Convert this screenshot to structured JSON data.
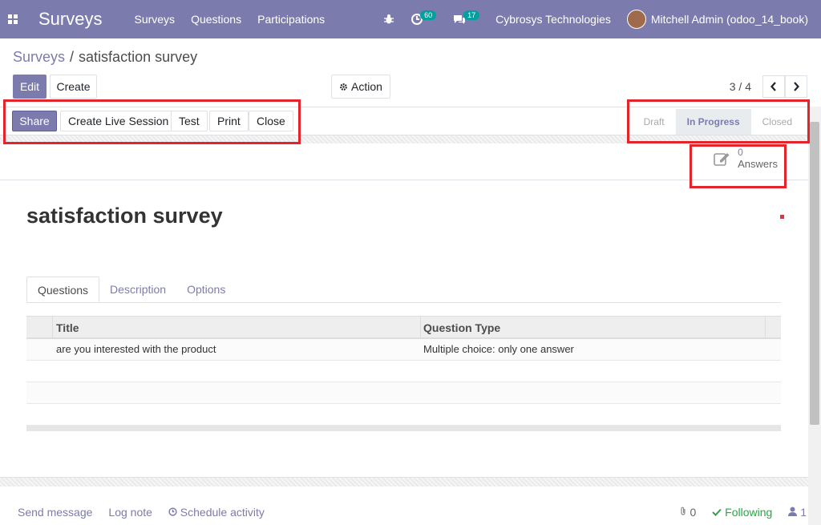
{
  "navbar": {
    "brand": "Surveys",
    "menu": [
      "Surveys",
      "Questions",
      "Participations"
    ],
    "activity_count": "60",
    "message_count": "17",
    "company": "Cybrosys Technologies",
    "user": "Mitchell Admin (odoo_14_book)"
  },
  "breadcrumb": {
    "parent": "Surveys",
    "separator": "/",
    "current": "satisfaction survey"
  },
  "control": {
    "edit": "Edit",
    "create": "Create",
    "action": "Action",
    "pager": "3 / 4"
  },
  "statusbar": {
    "buttons": [
      "Share",
      "Create Live Session",
      "Test",
      "Print",
      "Close"
    ],
    "stages": [
      "Draft",
      "In Progress",
      "Closed"
    ],
    "active_stage": "In Progress"
  },
  "stat": {
    "count": "0",
    "label": "Answers"
  },
  "form": {
    "title": "satisfaction survey"
  },
  "tabs": [
    "Questions",
    "Description",
    "Options"
  ],
  "table": {
    "columns": [
      "Title",
      "Question Type"
    ],
    "rows": [
      [
        "are you interested with the product",
        "Multiple choice: only one answer"
      ]
    ]
  },
  "chatter": {
    "send_message": "Send message",
    "log_note": "Log note",
    "schedule_activity": "Schedule activity",
    "attachments": "0",
    "following": "Following",
    "followers": "1"
  },
  "colors": {
    "primary": "#7c7bad",
    "annotation": "#e3242b"
  }
}
